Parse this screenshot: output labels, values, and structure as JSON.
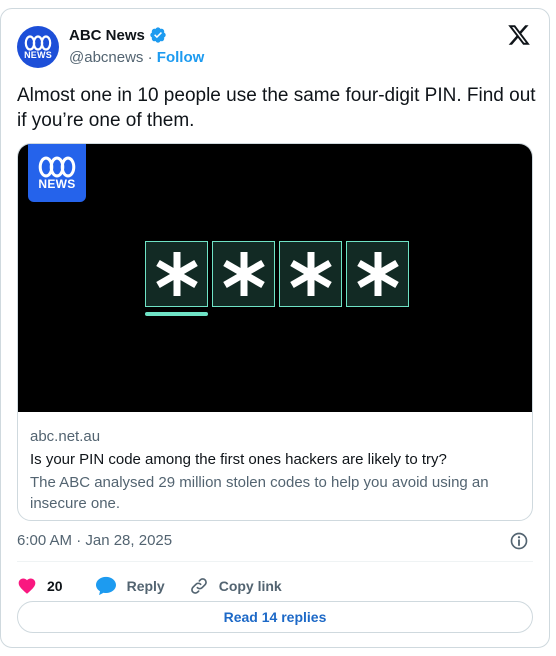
{
  "author": {
    "name": "ABC News",
    "handle": "@abcnews",
    "separator": "·",
    "follow_label": "Follow",
    "avatar_word": "NEWS",
    "verified": true
  },
  "tweet": {
    "text": "Almost one in 10 people use the same four-digit PIN. Find out if you’re one of them."
  },
  "link_card": {
    "badge_word": "NEWS",
    "pin_chars": [
      "*",
      "*",
      "*",
      "*"
    ],
    "domain": "abc.net.au",
    "title": "Is your PIN code among the first ones hackers are likely to try?",
    "description": "The ABC analysed 29 million stolen codes to help you avoid using an insecure one."
  },
  "timestamp": "6:00 AM · Jan 28, 2025",
  "actions": {
    "like_count": "20",
    "reply_label": "Reply",
    "copy_link_label": "Copy link"
  },
  "read_replies_label": "Read 14 replies",
  "colors": {
    "brand_blue": "#1d9bf0",
    "abc_blue": "#2563eb",
    "like_pink": "#f91880",
    "pin_teal": "#6fe3c6"
  }
}
